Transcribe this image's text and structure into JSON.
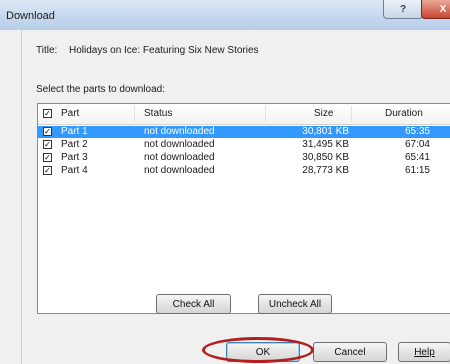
{
  "window": {
    "title": "Download"
  },
  "caption_buttons": {
    "help": "?",
    "close": "X"
  },
  "title_row": {
    "label": "Title:",
    "value": "Holidays on Ice: Featuring Six New Stories"
  },
  "select_label": "Select the parts to download:",
  "table": {
    "columns": [
      "Part",
      "Status",
      "Size",
      "Duration"
    ],
    "header_checked": true,
    "rows": [
      {
        "part": "Part 1",
        "status": "not downloaded",
        "size": "30,801 KB",
        "duration": "65:35",
        "checked": true,
        "selected": true
      },
      {
        "part": "Part 2",
        "status": "not downloaded",
        "size": "31,495 KB",
        "duration": "67:04",
        "checked": true,
        "selected": false
      },
      {
        "part": "Part 3",
        "status": "not downloaded",
        "size": "30,850 KB",
        "duration": "65:41",
        "checked": true,
        "selected": false
      },
      {
        "part": "Part 4",
        "status": "not downloaded",
        "size": "28,773 KB",
        "duration": "61:15",
        "checked": true,
        "selected": false
      }
    ]
  },
  "buttons": {
    "check_all": "Check All",
    "uncheck_all": "Uncheck All",
    "ok": "OK",
    "cancel": "Cancel",
    "help": "Help"
  },
  "annotation": {
    "color": "#b21f1f"
  },
  "colors": {
    "selection": "#3399ff",
    "titlebar": "#c6d8ee"
  }
}
